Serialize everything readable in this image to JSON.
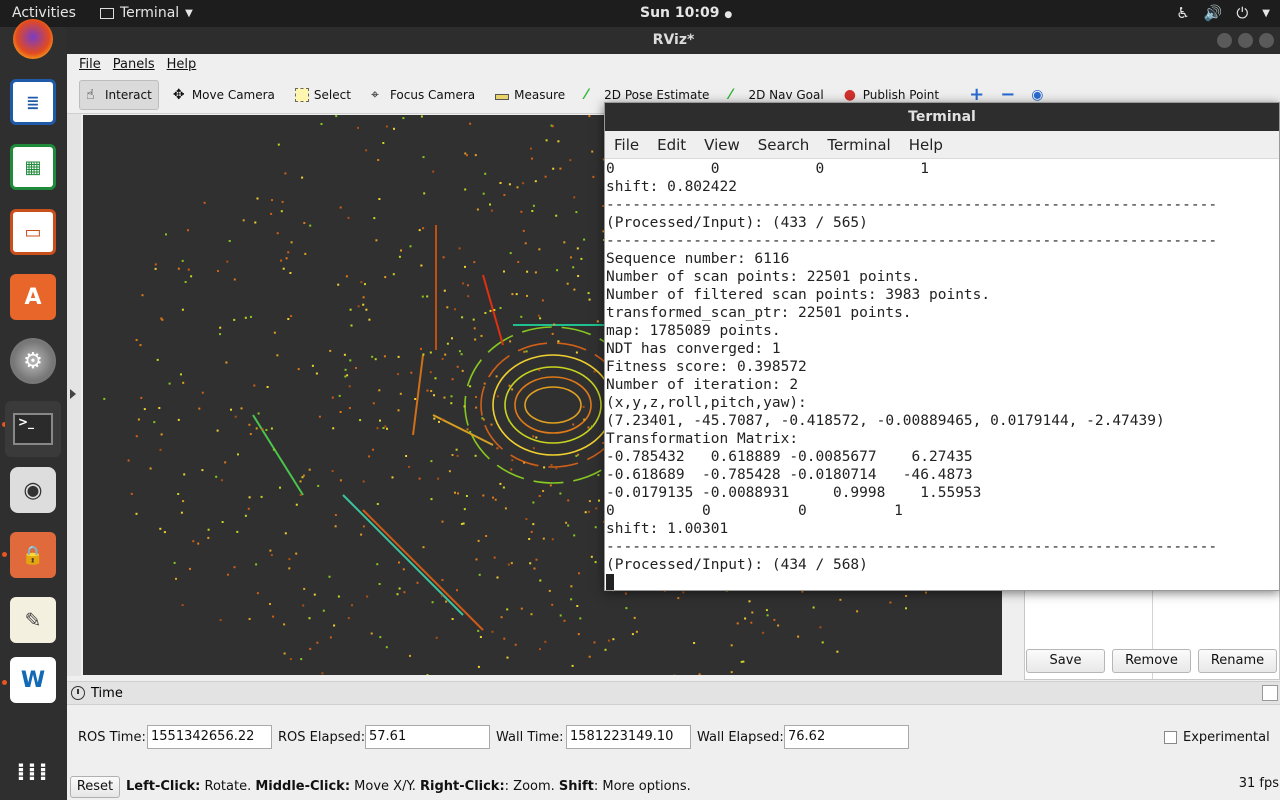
{
  "topbar": {
    "activities": "Activities",
    "app_name": "Terminal",
    "clock": "Sun 10:09",
    "icons": [
      "accessibility-icon",
      "volume-icon",
      "power-icon",
      "chevron-down-icon"
    ]
  },
  "dock": {
    "apps": [
      "firefox",
      "libreoffice-writer",
      "libreoffice-calc",
      "libreoffice-impress",
      "software-center",
      "system-settings",
      "terminal",
      "screenshot",
      "files",
      "text-editor",
      "autoware",
      "show-applications"
    ]
  },
  "rviz": {
    "title": "RViz*",
    "menu": [
      "File",
      "Panels",
      "Help"
    ],
    "tools": [
      {
        "label": "Interact",
        "icon": "hand-icon",
        "active": true
      },
      {
        "label": "Move Camera",
        "icon": "move-camera-icon"
      },
      {
        "label": "Select",
        "icon": "select-box-icon"
      },
      {
        "label": "Focus Camera",
        "icon": "focus-camera-icon"
      },
      {
        "label": "Measure",
        "icon": "ruler-icon"
      },
      {
        "label": "2D Pose Estimate",
        "icon": "pose-arrow-icon"
      },
      {
        "label": "2D Nav Goal",
        "icon": "nav-arrow-icon"
      },
      {
        "label": "Publish Point",
        "icon": "map-pin-icon"
      }
    ],
    "panel_buttons": {
      "save": "Save",
      "remove": "Remove",
      "rename": "Rename"
    },
    "time_panel": {
      "title": "Time",
      "ros_time_label": "ROS Time:",
      "ros_time": "1551342656.22",
      "ros_elapsed_label": "ROS Elapsed:",
      "ros_elapsed": "57.61",
      "wall_time_label": "Wall Time:",
      "wall_time": "1581223149.10",
      "wall_elapsed_label": "Wall Elapsed:",
      "wall_elapsed": "76.62",
      "experimental": "Experimental"
    },
    "status": {
      "reset": "Reset",
      "left_click": "Left-Click:",
      "left_click_desc": " Rotate. ",
      "middle_click": "Middle-Click:",
      "middle_click_desc": " Move X/Y. ",
      "right_click": "Right-Click:",
      "right_click_desc": ": Zoom. ",
      "shift": "Shift",
      "shift_desc": ": More options.",
      "fps": "31 fps"
    }
  },
  "terminal": {
    "title": "Terminal",
    "menu": [
      "File",
      "Edit",
      "View",
      "Search",
      "Terminal",
      "Help"
    ],
    "lines": [
      "0           0           0           1",
      "shift: 0.802422",
      "----------------------------------------------------------------------",
      "(Processed/Input): (433 / 565)",
      "----------------------------------------------------------------------",
      "Sequence number: 6116",
      "Number of scan points: 22501 points.",
      "Number of filtered scan points: 3983 points.",
      "transformed_scan_ptr: 22501 points.",
      "map: 1785089 points.",
      "NDT has converged: 1",
      "Fitness score: 0.398572",
      "Number of iteration: 2",
      "(x,y,z,roll,pitch,yaw):",
      "(7.23401, -45.7087, -0.418572, -0.00889465, 0.0179144, -2.47439)",
      "Transformation Matrix:",
      "-0.785432   0.618889 -0.0085677    6.27435",
      "-0.618689  -0.785428 -0.0180714   -46.4873",
      "-0.0179135 -0.0088931     0.9998    1.55953",
      "0          0          0          1",
      "shift: 1.00301",
      "----------------------------------------------------------------------",
      "(Processed/Input): (434 / 568)"
    ]
  }
}
